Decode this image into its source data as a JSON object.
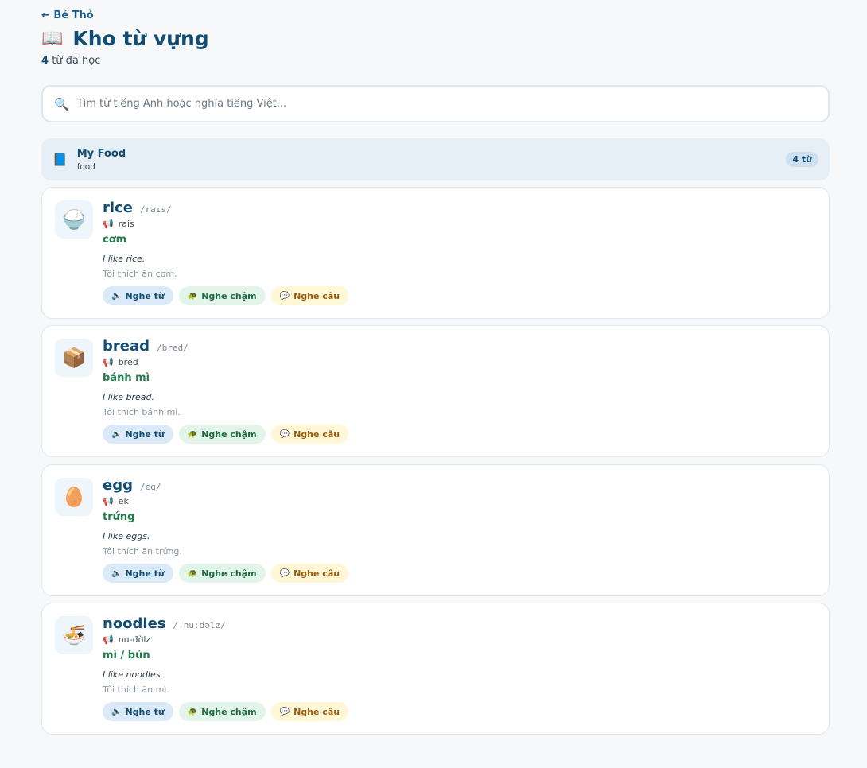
{
  "nav": {
    "back_label": "← Bé Thỏ"
  },
  "header": {
    "title_icon": "📖",
    "title": "Kho từ vựng",
    "count": "4",
    "count_suffix": "từ đã học"
  },
  "search": {
    "icon": "🔍",
    "placeholder": "Tìm từ tiếng Anh hoặc nghĩa tiếng Việt..."
  },
  "topic": {
    "icon": "📘",
    "name": "My Food",
    "sub": "food",
    "badge": "4 từ"
  },
  "buttons": {
    "listen_word": "Nghe từ",
    "listen_slow": "Nghe chậm",
    "listen_sentence": "Nghe câu",
    "listen_word_icon": "🔈",
    "listen_slow_icon": "🐢",
    "listen_sentence_icon": "💬",
    "sound_icon": "📢"
  },
  "words": [
    {
      "emoji": "🍚",
      "word": "rice",
      "ipa": "/raɪs/",
      "sound": "rais",
      "meaning": "cơm",
      "example": "I like rice.",
      "translation": "Tôi thích ăn cơm."
    },
    {
      "emoji": "📦",
      "word": "bread",
      "ipa": "/bred/",
      "sound": "bred",
      "meaning": "bánh mì",
      "example": "I like bread.",
      "translation": "Tôi thích bánh mì."
    },
    {
      "emoji": "🥚",
      "word": "egg",
      "ipa": "/eg/",
      "sound": "ek",
      "meaning": "trứng",
      "example": "I like eggs.",
      "translation": "Tôi thích ăn trứng."
    },
    {
      "emoji": "🍜",
      "word": "noodles",
      "ipa": "/ˈnuːdəlz/",
      "sound": "nu-đờlz",
      "meaning": "mì / bún",
      "example": "I like noodles.",
      "translation": "Tôi thích ăn mì."
    }
  ]
}
